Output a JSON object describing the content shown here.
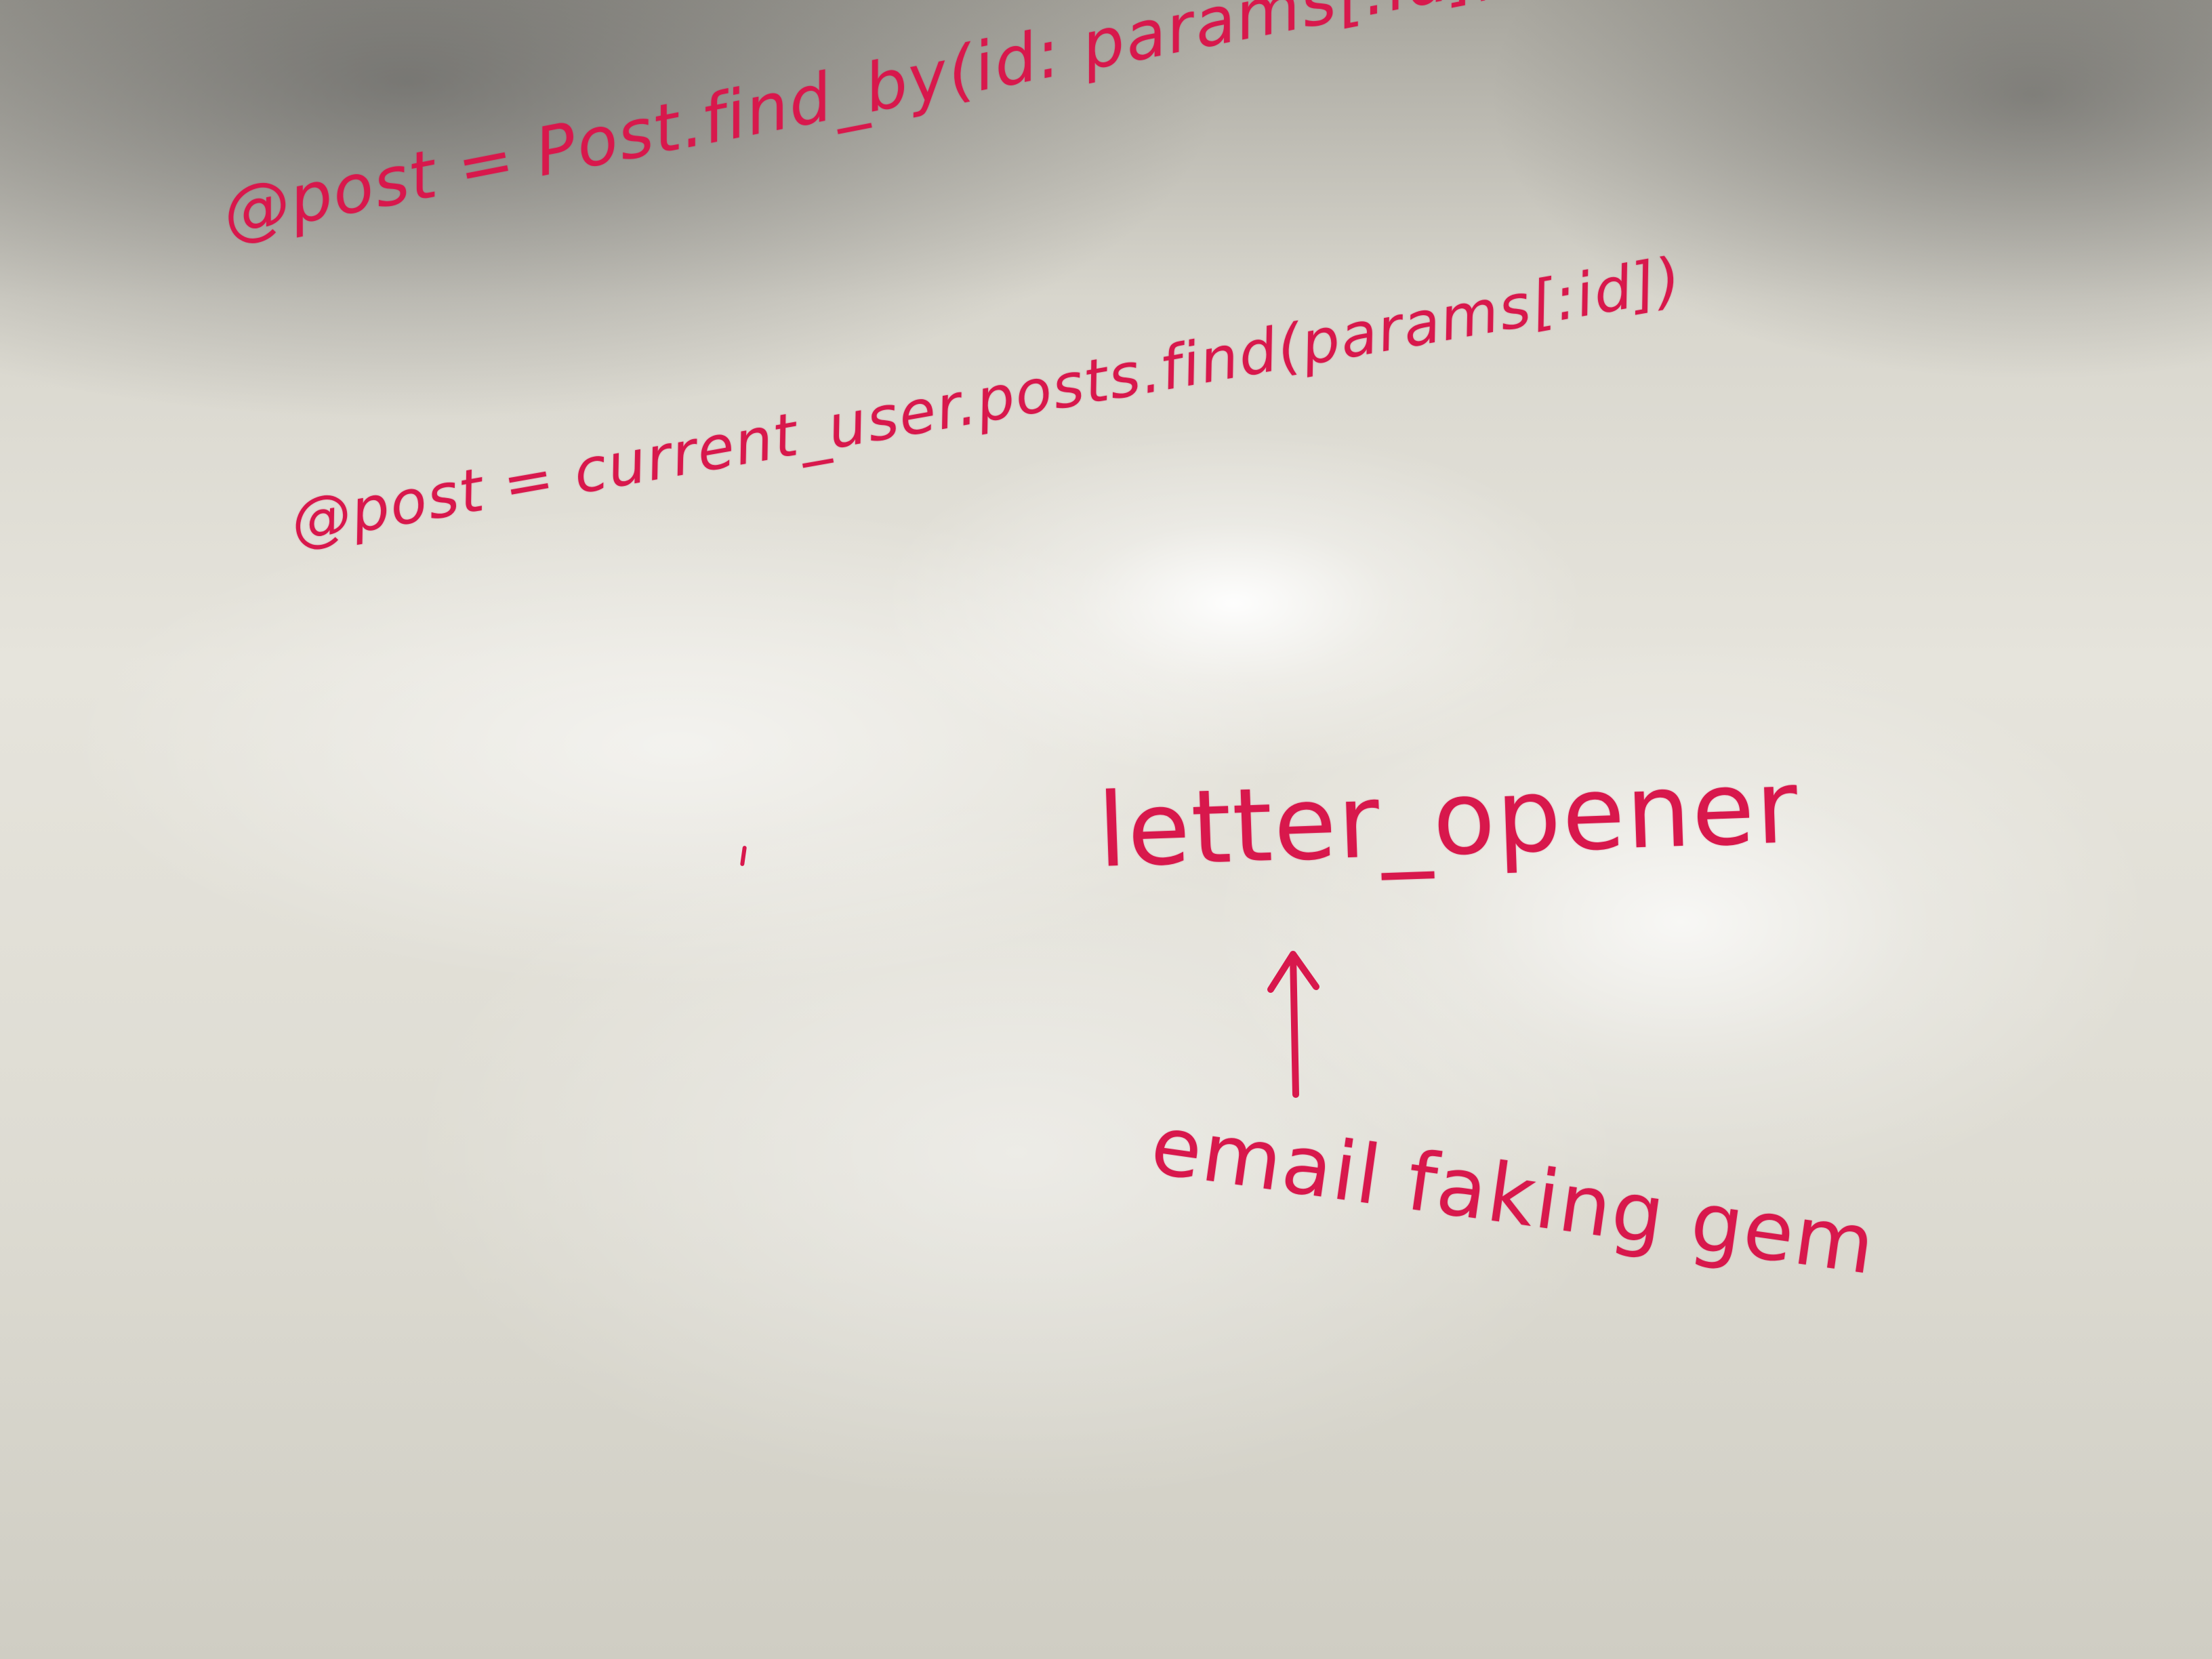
{
  "whiteboard": {
    "code_lines": [
      "@post = Post.find_by(id: params[:id], user_id: current_user.id)",
      "@post = current_user.posts.find(params[:id])"
    ],
    "gem_name": "letter_opener",
    "gem_caption": "email faking gem",
    "arrow_icon": "up-arrow-icon",
    "ink_color": "#d8184c",
    "board_color": "#e4e2da"
  }
}
